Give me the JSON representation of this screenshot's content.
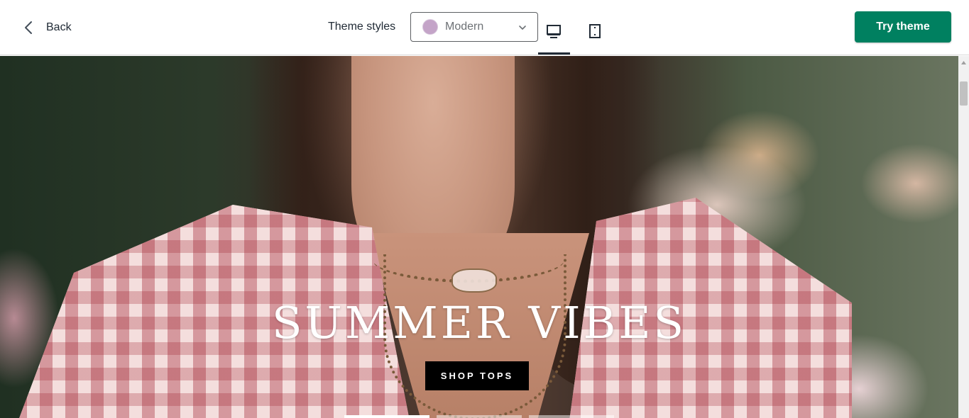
{
  "topbar": {
    "back_label": "Back",
    "theme_styles_label": "Theme styles",
    "selected_style": "Modern",
    "style_swatch_color": "#c4a4c8",
    "try_theme_label": "Try theme",
    "try_theme_color": "#008060",
    "active_device": "desktop"
  },
  "hero": {
    "title": "SUMMER VIBES",
    "cta_label": "SHOP TOPS",
    "slides_count": 3,
    "active_slide": 1
  },
  "icons": {
    "back": "chevron-left-icon",
    "caret": "chevron-down-icon",
    "desktop": "desktop-icon",
    "mobile": "mobile-icon"
  }
}
